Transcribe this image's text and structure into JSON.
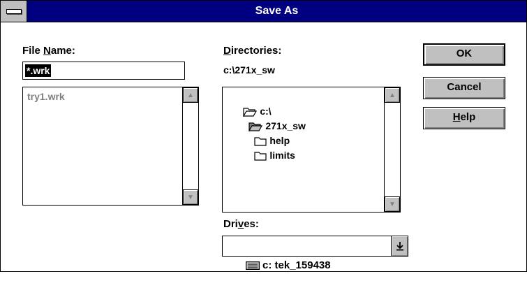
{
  "window": {
    "title": "Save As"
  },
  "file_name": {
    "label_pre": "File ",
    "label_u": "N",
    "label_post": "ame:",
    "value": "*.wrk"
  },
  "file_list": {
    "items": [
      "try1.wrk"
    ]
  },
  "directories": {
    "label_u": "D",
    "label_post": "irectories:",
    "current_path": "c:\\271x_sw",
    "items": [
      {
        "name": "c:\\",
        "icon": "open-folder-icon"
      },
      {
        "name": "271x_sw",
        "icon": "open-folder-icon"
      },
      {
        "name": "help",
        "icon": "folder-icon"
      },
      {
        "name": "limits",
        "icon": "folder-icon"
      }
    ]
  },
  "drives": {
    "label_pre": "Dri",
    "label_u": "v",
    "label_post": "es:",
    "selected": "c: tek_159438"
  },
  "buttons": {
    "ok": "OK",
    "cancel": "Cancel",
    "help_u": "H",
    "help_post": "elp"
  }
}
